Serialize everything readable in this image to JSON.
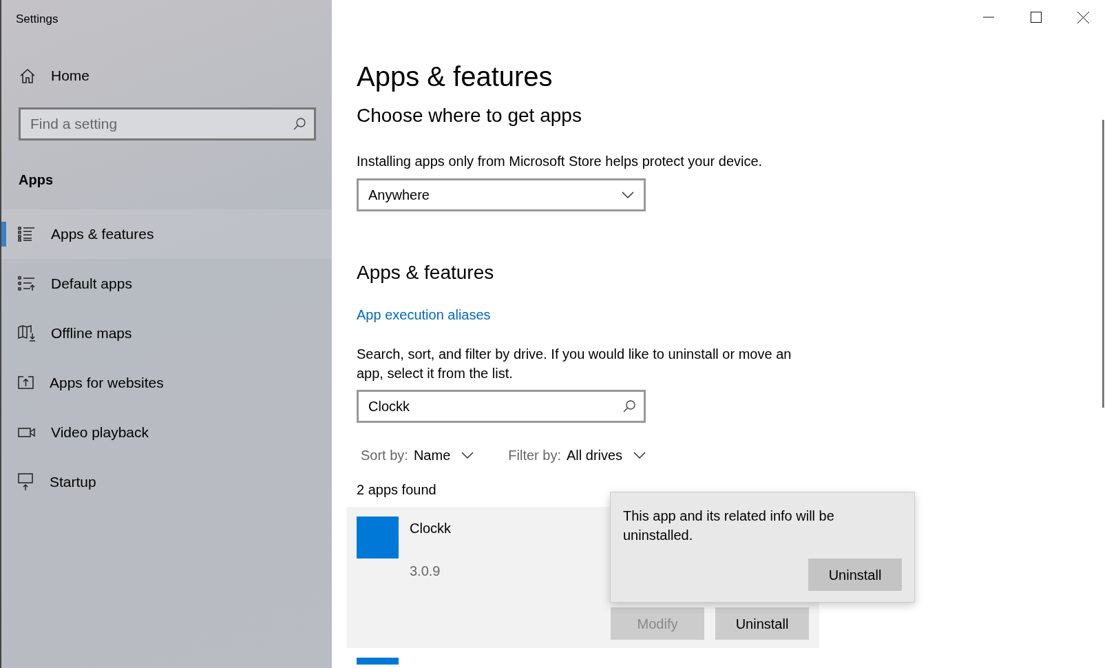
{
  "window": {
    "title": "Settings"
  },
  "sidebar": {
    "home": "Home",
    "search": {
      "placeholder": "Find a setting"
    },
    "section": "Apps",
    "items": [
      {
        "label": "Apps & features",
        "selected": true
      },
      {
        "label": "Default apps",
        "selected": false
      },
      {
        "label": "Offline maps",
        "selected": false
      },
      {
        "label": "Apps for websites",
        "selected": false
      },
      {
        "label": "Video playback",
        "selected": false
      },
      {
        "label": "Startup",
        "selected": false
      }
    ]
  },
  "page": {
    "title": "Apps & features",
    "source_heading": "Choose where to get apps",
    "source_note": "Installing apps only from Microsoft Store helps protect your device.",
    "source_value": "Anywhere",
    "section_heading": "Apps & features",
    "aliases_link": "App execution aliases",
    "search_note": "Search, sort, and filter by drive. If you would like to uninstall or move an app, select it from the list.",
    "search_value": "Clockk",
    "sort": {
      "label": "Sort by:",
      "value": "Name"
    },
    "filter": {
      "label": "Filter by:",
      "value": "All drives"
    },
    "count": "2 apps found",
    "apps": [
      {
        "name": "Clockk",
        "version": "3.0.9",
        "selected": true,
        "buttons": [
          {
            "label": "Modify",
            "disabled": true
          },
          {
            "label": "Uninstall",
            "disabled": false
          }
        ]
      }
    ],
    "flyout": {
      "message": "This app and its related info will be uninstalled.",
      "button": "Uninstall"
    }
  }
}
